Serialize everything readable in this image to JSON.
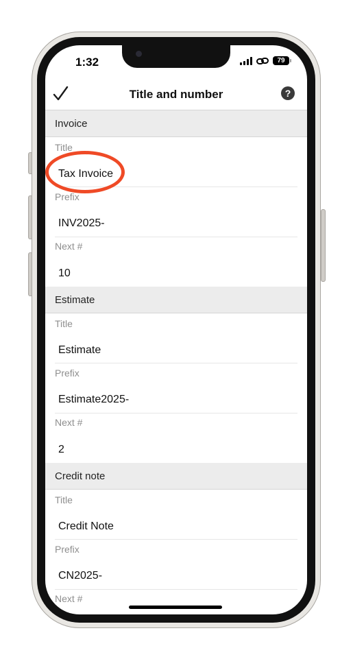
{
  "status_bar": {
    "time": "1:32",
    "battery": "79"
  },
  "navbar": {
    "title": "Title and number",
    "help_label": "?"
  },
  "sections": [
    {
      "header": "Invoice",
      "fields": [
        {
          "label": "Title",
          "value": "Tax Invoice"
        },
        {
          "label": "Prefix",
          "value": "INV2025-"
        },
        {
          "label": "Next #",
          "value": "10"
        }
      ]
    },
    {
      "header": "Estimate",
      "fields": [
        {
          "label": "Title",
          "value": "Estimate"
        },
        {
          "label": "Prefix",
          "value": "Estimate2025-"
        },
        {
          "label": "Next #",
          "value": "2"
        }
      ]
    },
    {
      "header": "Credit note",
      "fields": [
        {
          "label": "Title",
          "value": "Credit Note"
        },
        {
          "label": "Prefix",
          "value": "CN2025-"
        },
        {
          "label": "Next #",
          "value": ""
        }
      ]
    }
  ],
  "colors": {
    "highlight": "#ef4a26",
    "section_bg": "#ececec"
  }
}
